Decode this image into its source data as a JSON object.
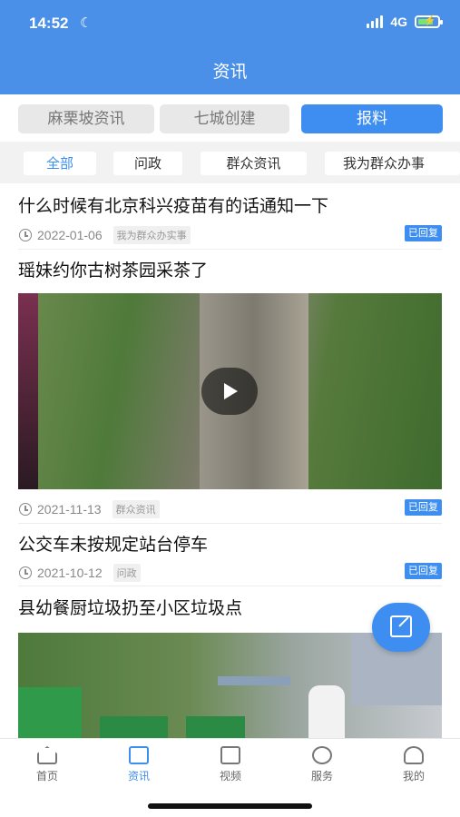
{
  "status_bar": {
    "time": "14:52",
    "network": "4G"
  },
  "header": {
    "title": "资讯"
  },
  "segments": [
    "麻栗坡资讯",
    "七城创建",
    "报料"
  ],
  "filters": [
    "全部",
    "问政",
    "群众资讯",
    "我为群众办事"
  ],
  "items": [
    {
      "title": "什么时候有北京科兴疫苗有的话通知一下",
      "date": "2022-01-06",
      "tag": "我为群众办实事",
      "status": "已回复"
    },
    {
      "title": "瑶妹约你古树茶园采茶了",
      "date": "2021-11-13",
      "tag": "群众资讯",
      "status": "已回复"
    },
    {
      "title": "公交车未按规定站台停车",
      "date": "2021-10-12",
      "tag": "问政",
      "status": "已回复"
    },
    {
      "title": "县幼餐厨垃圾扔至小区垃圾点"
    }
  ],
  "tabs": [
    "首页",
    "资讯",
    "视频",
    "服务",
    "我的"
  ],
  "colors": {
    "primary": "#4a90e8",
    "accent": "#3d8ef0"
  }
}
